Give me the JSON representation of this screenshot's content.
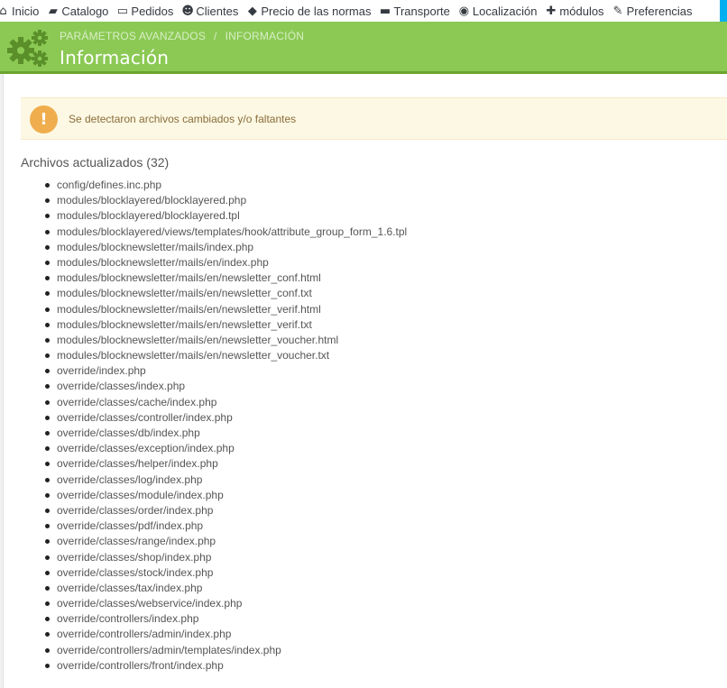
{
  "nav": {
    "items": [
      {
        "icon": "home-icon",
        "glyph": "⌂",
        "label": "Inicio"
      },
      {
        "icon": "book-icon",
        "glyph": "▰",
        "label": "Catalogo"
      },
      {
        "icon": "credit-card-icon",
        "glyph": "▭",
        "label": "Pedidos"
      },
      {
        "icon": "users-icon",
        "glyph": "☻",
        "label": "Clientes"
      },
      {
        "icon": "tags-icon",
        "glyph": "◆",
        "label": "Precio de las normas"
      },
      {
        "icon": "truck-icon",
        "glyph": "▬",
        "label": "Transporte"
      },
      {
        "icon": "globe-icon",
        "glyph": "◉",
        "label": "Localización"
      },
      {
        "icon": "puzzle-icon",
        "glyph": "✚",
        "label": "módulos"
      },
      {
        "icon": "wrench-icon",
        "glyph": "✎",
        "label": "Preferencias"
      }
    ]
  },
  "header": {
    "breadcrumb": [
      "PARÁMETROS AVANZADOS",
      "/",
      "INFORMACIÓN"
    ],
    "title": "Información",
    "icon": "gears-icon"
  },
  "alert": {
    "icon": "!",
    "text": "Se detectaron archivos cambiados y/o faltantes"
  },
  "files": {
    "title": "Archivos actualizados (32)",
    "items": [
      "config/defines.inc.php",
      "modules/blocklayered/blocklayered.php",
      "modules/blocklayered/blocklayered.tpl",
      "modules/blocklayered/views/templates/hook/attribute_group_form_1.6.tpl",
      "modules/blocknewsletter/mails/index.php",
      "modules/blocknewsletter/mails/en/index.php",
      "modules/blocknewsletter/mails/en/newsletter_conf.html",
      "modules/blocknewsletter/mails/en/newsletter_conf.txt",
      "modules/blocknewsletter/mails/en/newsletter_verif.html",
      "modules/blocknewsletter/mails/en/newsletter_verif.txt",
      "modules/blocknewsletter/mails/en/newsletter_voucher.html",
      "modules/blocknewsletter/mails/en/newsletter_voucher.txt",
      "override/index.php",
      "override/classes/index.php",
      "override/classes/cache/index.php",
      "override/classes/controller/index.php",
      "override/classes/db/index.php",
      "override/classes/exception/index.php",
      "override/classes/helper/index.php",
      "override/classes/log/index.php",
      "override/classes/module/index.php",
      "override/classes/order/index.php",
      "override/classes/pdf/index.php",
      "override/classes/range/index.php",
      "override/classes/shop/index.php",
      "override/classes/stock/index.php",
      "override/classes/tax/index.php",
      "override/classes/webservice/index.php",
      "override/controllers/index.php",
      "override/controllers/admin/index.php",
      "override/controllers/admin/templates/index.php",
      "override/controllers/front/index.php"
    ]
  },
  "colors": {
    "header_green": "#8bc954",
    "alert_bg": "#fcf8e3",
    "alert_icon": "#f0ad4e",
    "alert_text": "#8a6d3b",
    "nav_accent": "#00aff0"
  }
}
